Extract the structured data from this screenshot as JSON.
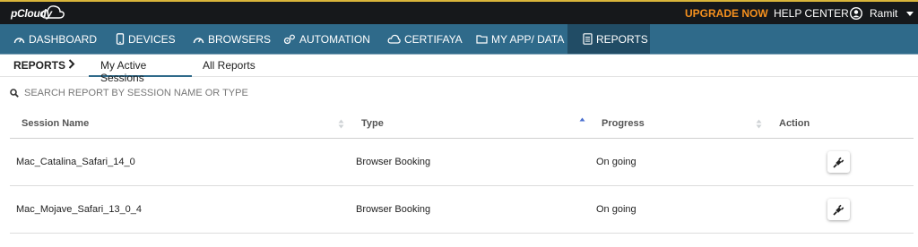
{
  "topbar": {
    "logo_text": "pCloudy",
    "upgrade_label": "UPGRADE NOW",
    "help_label": "HELP CENTER",
    "user_name": "Ramit"
  },
  "nav": {
    "items": [
      {
        "label": "DASHBOARD",
        "icon": "gauge-icon"
      },
      {
        "label": "DEVICES",
        "icon": "phone-icon"
      },
      {
        "label": "BROWSERS",
        "icon": "gauge-icon"
      },
      {
        "label": "AUTOMATION",
        "icon": "gears-icon"
      },
      {
        "label": "CERTIFAYA",
        "icon": "cloud-icon"
      },
      {
        "label": "MY APP/ DATA",
        "icon": "folder-icon"
      },
      {
        "label": "REPORTS",
        "icon": "document-icon",
        "active": true
      }
    ]
  },
  "tabs": {
    "breadcrumb": "REPORTS",
    "items": [
      {
        "label": "My Active Sessions",
        "active": true
      },
      {
        "label": "All Reports",
        "active": false
      }
    ]
  },
  "search": {
    "placeholder": "SEARCH REPORT BY SESSION NAME OR TYPE",
    "value": ""
  },
  "table": {
    "columns": [
      "Session Name",
      "Type",
      "Progress",
      "Action"
    ],
    "rows": [
      {
        "session_name": "Mac_Catalina_Safari_14_0",
        "type": "Browser Booking",
        "progress": "On going",
        "action_icon": "plug-icon"
      },
      {
        "session_name": "Mac_Mojave_Safari_13_0_4",
        "type": "Browser Booking",
        "progress": "On going",
        "action_icon": "plug-icon"
      }
    ]
  },
  "colors": {
    "nav_bg": "#2f6a8a",
    "nav_active_bg": "#214c65",
    "topbar_bg": "#16181b",
    "upgrade": "#f5901e"
  }
}
